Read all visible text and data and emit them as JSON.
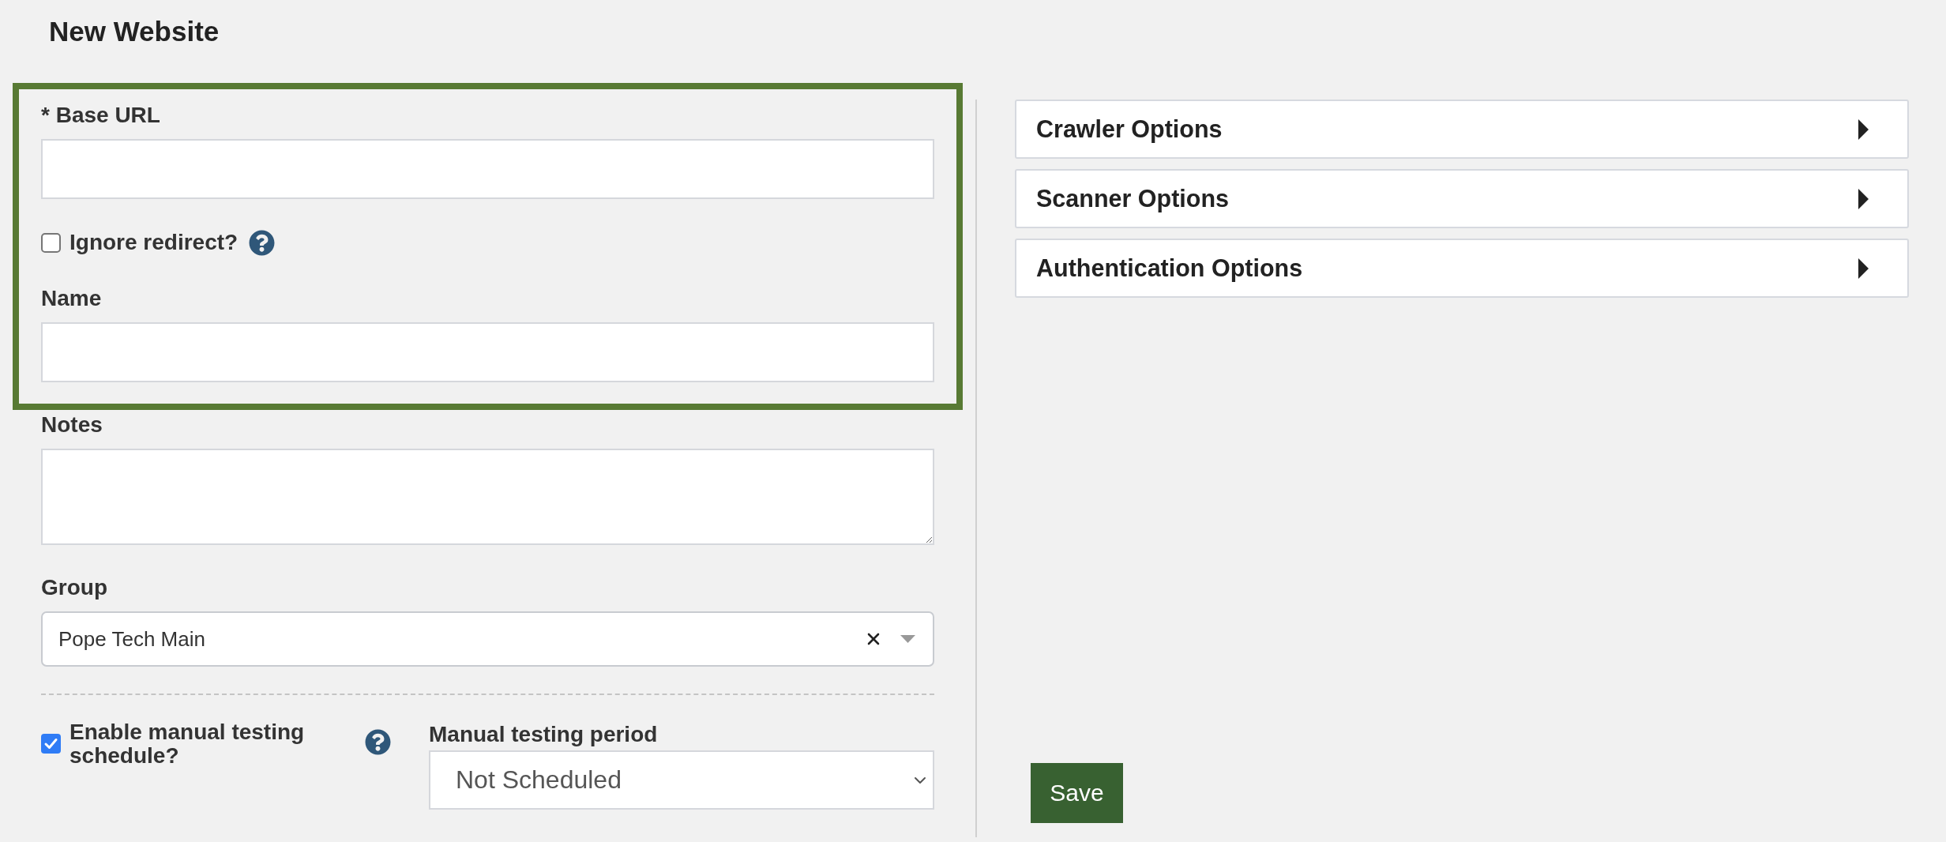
{
  "page": {
    "title": "New Website"
  },
  "form": {
    "fields": [
      {
        "kind": "text",
        "label": "* Base URL",
        "highlighted": true
      },
      {
        "kind": "checkbox",
        "label": "Ignore redirect?",
        "checked": false,
        "help": true,
        "highlighted": true
      },
      {
        "kind": "text",
        "label": "Name",
        "highlighted": true
      },
      {
        "kind": "textarea",
        "label": "Notes",
        "highlighted": false
      },
      {
        "kind": "select",
        "label": "Group",
        "value": "Pope Tech Main",
        "clearable": true,
        "highlighted": false
      }
    ],
    "schedule": {
      "label": "Enable manual testing schedule?",
      "checked": true,
      "help": true
    },
    "period": {
      "label": "Manual testing period",
      "value": "Not Scheduled"
    }
  },
  "option_panels": [
    {
      "title": "Crawler Options",
      "expanded": false
    },
    {
      "title": "Scanner Options",
      "expanded": false
    },
    {
      "title": "Authentication Options",
      "expanded": false
    }
  ],
  "save_button": {
    "label": "Save"
  }
}
